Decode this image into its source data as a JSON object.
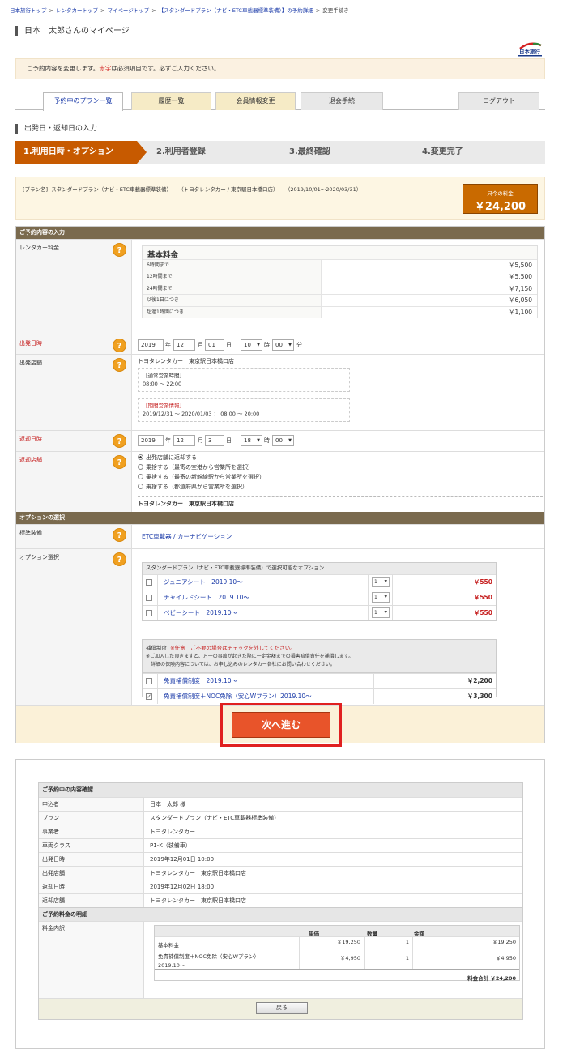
{
  "breadcrumb": [
    "日本旅行トップ",
    "レンタカートップ",
    "マイページトップ",
    "【スタンダードプラン（ナビ・ETC車載器標準装備）】の予約詳細",
    "変更手続き"
  ],
  "page_title": "日本　太郎さんのマイページ",
  "logo_text": "日本旅行",
  "notice": {
    "pre": "ご予約内容を変更します。",
    "red": "赤字",
    "post": "は必須項目です。必ずご入力ください。"
  },
  "tabs": [
    "予約中のプラン一覧",
    "履歴一覧",
    "会員情報変更",
    "退会手続",
    "ログアウト"
  ],
  "section_title": "出発日・返却日の入力",
  "steps": [
    "1.利用日時・オプション",
    "2.利用者登録",
    "3.最終確認",
    "4.変更完了"
  ],
  "plan": {
    "label": "[プラン名]",
    "name": "スタンダードプラン（ナビ・ETC車載器標準装備）",
    "company": "（トヨタレンタカー / 東京駅日本橋口店）",
    "period": "（2019/10/01〜2020/03/31）",
    "price_label": "只今の料金",
    "price": "￥24,200"
  },
  "form": {
    "header1": "ご予約内容の入力",
    "fee_label": "レンタカー料金",
    "fee_title": "基本料金",
    "fees": [
      {
        "k": "6時間まで",
        "v": "￥5,500"
      },
      {
        "k": "12時間まで",
        "v": "￥5,500"
      },
      {
        "k": "24時間まで",
        "v": "￥7,150"
      },
      {
        "k": "以後1日につき",
        "v": "￥6,050"
      },
      {
        "k": "超過1時間につき",
        "v": "￥1,100"
      }
    ],
    "depart_label": "出発日時",
    "depart": {
      "y": "2019",
      "m": "12",
      "d": "01",
      "h": "10",
      "min": "00"
    },
    "units": {
      "y": "年",
      "m": "月",
      "d": "日",
      "h": "時",
      "min": "分"
    },
    "store_label": "出発店舗",
    "store": "トヨタレンタカー　東京駅日本橋口店",
    "hours_title": "［通常営業時間］",
    "hours": "08:00 〜 22:00",
    "special_title": "［期間営業情報］",
    "special": "2019/12/31 〜 2020/01/03 ： 08:00 〜 20:00",
    "return_label": "返却日時",
    "return": {
      "y": "2019",
      "m": "12",
      "d": "3",
      "h": "18",
      "min": "00"
    },
    "return_store_label": "返却店舗",
    "return_opts": [
      "出発店舗に返却する",
      "乗捨する（最寄の空港から営業所を選択）",
      "乗捨する（最寄の新幹線駅から営業所を選択）",
      "乗捨する（都道府県から営業所を選択）"
    ],
    "return_store": "トヨタレンタカー　東京駅日本橋口店",
    "header2": "オプションの選択",
    "std_label": "標準装備",
    "std_items": "ETC車載器 / カーナビゲーション",
    "opt_label": "オプション選択",
    "opt_head": "スタンダードプラン（ナビ・ETC車載器標準装備）で選択可能なオプション",
    "options": [
      {
        "n": "ジュニアシート　2019.10〜",
        "q": "1",
        "p": "￥550"
      },
      {
        "n": "チャイルドシート　2019.10〜",
        "q": "1",
        "p": "￥550"
      },
      {
        "n": "ベビーシート　2019.10〜",
        "q": "1",
        "p": "￥550"
      }
    ],
    "ins_title": "補償制度",
    "ins_red": "※任意　ご不要の場合はチェックを外してください。",
    "ins_note1": "※ご加入した頂きますと、万一の事故が起きた際に一定金額までの損害賠償責任を補償します。",
    "ins_note2": "詳細の保険内容については、お申し込みのレンタカー各社にお問い合わせください。",
    "insurance": [
      {
        "n": "免責補償制度　2019.10〜",
        "p": "￥2,200",
        "checked": false
      },
      {
        "n": "免責補償制度＋NOC免除（安心Wプラン）2019.10〜",
        "p": "￥3,300",
        "checked": true
      }
    ],
    "next": "次へ進む"
  },
  "confirm": {
    "header": "ご予約中の内容確認",
    "rows": [
      {
        "k": "申込者",
        "v": "日本　太郎 様"
      },
      {
        "k": "プラン",
        "v": "スタンダードプラン（ナビ・ETC車載器標準装備）"
      },
      {
        "k": "事業者",
        "v": "トヨタレンタカー"
      },
      {
        "k": "車両クラス",
        "v": "P1-K（装備車）"
      },
      {
        "k": "出発日時",
        "v": "2019年12月01日 10:00"
      },
      {
        "k": "出発店舗",
        "v": "トヨタレンタカー　東京駅日本橋口店"
      },
      {
        "k": "返却日時",
        "v": "2019年12月02日 18:00"
      },
      {
        "k": "返却店舗",
        "v": "トヨタレンタカー　東京駅日本橋口店"
      }
    ],
    "fee_header": "ご予約料金の明細",
    "fee_label": "料金内訳",
    "cols": [
      "単価",
      "数量",
      "金額"
    ],
    "items": [
      {
        "n": "基本料金",
        "u": "￥19,250",
        "q": "1",
        "a": "￥19,250"
      },
      {
        "n": "免責補償制度＋NOC免除（安心Wプラン）",
        "n2": "2019.10〜",
        "u": "￥4,950",
        "q": "1",
        "a": "￥4,950"
      }
    ],
    "total": "料金合計 ￥24,200",
    "back": "戻る"
  }
}
